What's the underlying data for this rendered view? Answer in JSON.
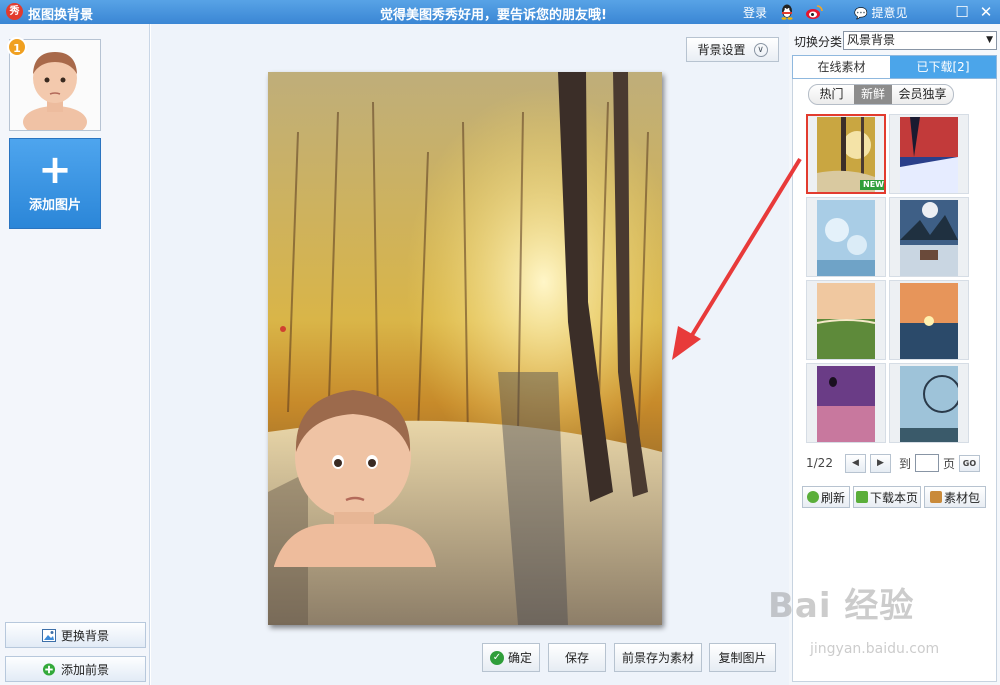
{
  "titlebar": {
    "logo": "秀",
    "app_title": "抠图换背景",
    "slogan": "觉得美图秀秀好用，要告诉您的朋友哦!",
    "login": "登录",
    "feedback": "提意见",
    "qq_icon": "qq-icon",
    "weibo_icon": "weibo-icon",
    "restore_glyph": "☐",
    "close_glyph": "✕"
  },
  "left": {
    "thumb_badge": "1",
    "add_plus": "+",
    "add_label": "添加图片",
    "change_bg": "更换背景",
    "add_fg": "添加前景"
  },
  "canvas": {
    "bg_settings": "背景设置",
    "bg_settings_chevron": "∨"
  },
  "bottom": {
    "confirm": "确定",
    "save": "保存",
    "save_fg": "前景存为素材",
    "copy": "复制图片"
  },
  "right": {
    "cat_label": "切换分类",
    "cat_value": "风景背景",
    "tab_online": "在线素材",
    "tab_downloaded": "已下载[2]",
    "sub_hot": "热门",
    "sub_new": "新鲜",
    "sub_vip": "会员独享",
    "new_tag": "NEW",
    "page_info": "1/22",
    "goto": "到",
    "page_unit": "页",
    "go": "GO",
    "refresh": "刷新",
    "download_page": "下载本页",
    "pack": "素材包"
  },
  "watermark": {
    "brand": "Bai 经验",
    "url": "jingyan.baidu.com"
  },
  "colors": {
    "titlebar": "#3a86d4",
    "accent": "#4ba5ea",
    "selection": "#e23b2e",
    "arrow": "#e83a3a"
  }
}
